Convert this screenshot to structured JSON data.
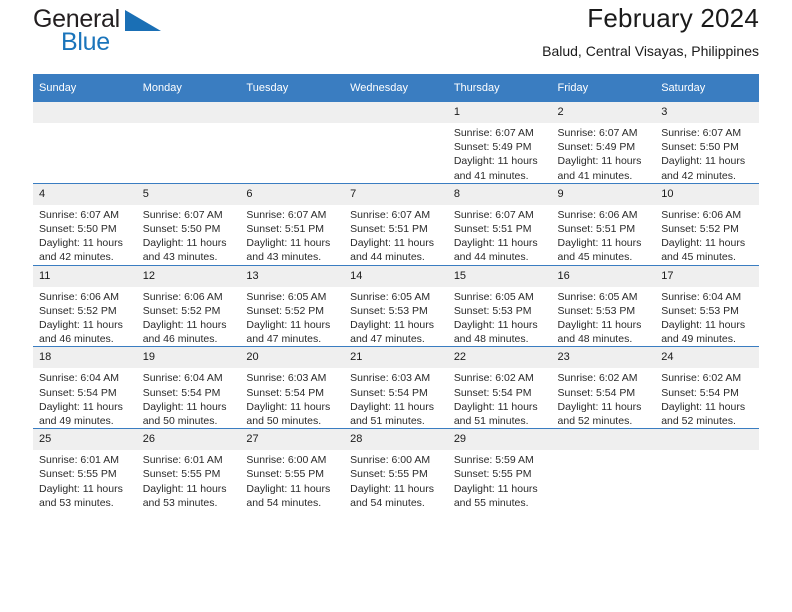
{
  "brand": {
    "name_top": "General",
    "name_bottom": "Blue",
    "triangle_icon": "triangle-icon",
    "color_top": "#231f20",
    "color_bottom": "#1a74bb"
  },
  "header": {
    "title": "February 2024",
    "subtitle": "Balud, Central Visayas, Philippines"
  },
  "theme": {
    "header_bg": "#3a7dc1",
    "header_text": "#ffffff",
    "daynum_bg": "#efefef",
    "cell_bg": "#ffffff",
    "grid_line": "#3a7dc1"
  },
  "weekday_headers": [
    "Sunday",
    "Monday",
    "Tuesday",
    "Wednesday",
    "Thursday",
    "Friday",
    "Saturday"
  ],
  "weeks": [
    [
      {
        "day": "",
        "sunrise": "",
        "sunset": "",
        "daylight_line1": "",
        "daylight_line2": ""
      },
      {
        "day": "",
        "sunrise": "",
        "sunset": "",
        "daylight_line1": "",
        "daylight_line2": ""
      },
      {
        "day": "",
        "sunrise": "",
        "sunset": "",
        "daylight_line1": "",
        "daylight_line2": ""
      },
      {
        "day": "",
        "sunrise": "",
        "sunset": "",
        "daylight_line1": "",
        "daylight_line2": ""
      },
      {
        "day": "1",
        "sunrise": "Sunrise: 6:07 AM",
        "sunset": "Sunset: 5:49 PM",
        "daylight_line1": "Daylight: 11 hours",
        "daylight_line2": "and 41 minutes."
      },
      {
        "day": "2",
        "sunrise": "Sunrise: 6:07 AM",
        "sunset": "Sunset: 5:49 PM",
        "daylight_line1": "Daylight: 11 hours",
        "daylight_line2": "and 41 minutes."
      },
      {
        "day": "3",
        "sunrise": "Sunrise: 6:07 AM",
        "sunset": "Sunset: 5:50 PM",
        "daylight_line1": "Daylight: 11 hours",
        "daylight_line2": "and 42 minutes."
      }
    ],
    [
      {
        "day": "4",
        "sunrise": "Sunrise: 6:07 AM",
        "sunset": "Sunset: 5:50 PM",
        "daylight_line1": "Daylight: 11 hours",
        "daylight_line2": "and 42 minutes."
      },
      {
        "day": "5",
        "sunrise": "Sunrise: 6:07 AM",
        "sunset": "Sunset: 5:50 PM",
        "daylight_line1": "Daylight: 11 hours",
        "daylight_line2": "and 43 minutes."
      },
      {
        "day": "6",
        "sunrise": "Sunrise: 6:07 AM",
        "sunset": "Sunset: 5:51 PM",
        "daylight_line1": "Daylight: 11 hours",
        "daylight_line2": "and 43 minutes."
      },
      {
        "day": "7",
        "sunrise": "Sunrise: 6:07 AM",
        "sunset": "Sunset: 5:51 PM",
        "daylight_line1": "Daylight: 11 hours",
        "daylight_line2": "and 44 minutes."
      },
      {
        "day": "8",
        "sunrise": "Sunrise: 6:07 AM",
        "sunset": "Sunset: 5:51 PM",
        "daylight_line1": "Daylight: 11 hours",
        "daylight_line2": "and 44 minutes."
      },
      {
        "day": "9",
        "sunrise": "Sunrise: 6:06 AM",
        "sunset": "Sunset: 5:51 PM",
        "daylight_line1": "Daylight: 11 hours",
        "daylight_line2": "and 45 minutes."
      },
      {
        "day": "10",
        "sunrise": "Sunrise: 6:06 AM",
        "sunset": "Sunset: 5:52 PM",
        "daylight_line1": "Daylight: 11 hours",
        "daylight_line2": "and 45 minutes."
      }
    ],
    [
      {
        "day": "11",
        "sunrise": "Sunrise: 6:06 AM",
        "sunset": "Sunset: 5:52 PM",
        "daylight_line1": "Daylight: 11 hours",
        "daylight_line2": "and 46 minutes."
      },
      {
        "day": "12",
        "sunrise": "Sunrise: 6:06 AM",
        "sunset": "Sunset: 5:52 PM",
        "daylight_line1": "Daylight: 11 hours",
        "daylight_line2": "and 46 minutes."
      },
      {
        "day": "13",
        "sunrise": "Sunrise: 6:05 AM",
        "sunset": "Sunset: 5:52 PM",
        "daylight_line1": "Daylight: 11 hours",
        "daylight_line2": "and 47 minutes."
      },
      {
        "day": "14",
        "sunrise": "Sunrise: 6:05 AM",
        "sunset": "Sunset: 5:53 PM",
        "daylight_line1": "Daylight: 11 hours",
        "daylight_line2": "and 47 minutes."
      },
      {
        "day": "15",
        "sunrise": "Sunrise: 6:05 AM",
        "sunset": "Sunset: 5:53 PM",
        "daylight_line1": "Daylight: 11 hours",
        "daylight_line2": "and 48 minutes."
      },
      {
        "day": "16",
        "sunrise": "Sunrise: 6:05 AM",
        "sunset": "Sunset: 5:53 PM",
        "daylight_line1": "Daylight: 11 hours",
        "daylight_line2": "and 48 minutes."
      },
      {
        "day": "17",
        "sunrise": "Sunrise: 6:04 AM",
        "sunset": "Sunset: 5:53 PM",
        "daylight_line1": "Daylight: 11 hours",
        "daylight_line2": "and 49 minutes."
      }
    ],
    [
      {
        "day": "18",
        "sunrise": "Sunrise: 6:04 AM",
        "sunset": "Sunset: 5:54 PM",
        "daylight_line1": "Daylight: 11 hours",
        "daylight_line2": "and 49 minutes."
      },
      {
        "day": "19",
        "sunrise": "Sunrise: 6:04 AM",
        "sunset": "Sunset: 5:54 PM",
        "daylight_line1": "Daylight: 11 hours",
        "daylight_line2": "and 50 minutes."
      },
      {
        "day": "20",
        "sunrise": "Sunrise: 6:03 AM",
        "sunset": "Sunset: 5:54 PM",
        "daylight_line1": "Daylight: 11 hours",
        "daylight_line2": "and 50 minutes."
      },
      {
        "day": "21",
        "sunrise": "Sunrise: 6:03 AM",
        "sunset": "Sunset: 5:54 PM",
        "daylight_line1": "Daylight: 11 hours",
        "daylight_line2": "and 51 minutes."
      },
      {
        "day": "22",
        "sunrise": "Sunrise: 6:02 AM",
        "sunset": "Sunset: 5:54 PM",
        "daylight_line1": "Daylight: 11 hours",
        "daylight_line2": "and 51 minutes."
      },
      {
        "day": "23",
        "sunrise": "Sunrise: 6:02 AM",
        "sunset": "Sunset: 5:54 PM",
        "daylight_line1": "Daylight: 11 hours",
        "daylight_line2": "and 52 minutes."
      },
      {
        "day": "24",
        "sunrise": "Sunrise: 6:02 AM",
        "sunset": "Sunset: 5:54 PM",
        "daylight_line1": "Daylight: 11 hours",
        "daylight_line2": "and 52 minutes."
      }
    ],
    [
      {
        "day": "25",
        "sunrise": "Sunrise: 6:01 AM",
        "sunset": "Sunset: 5:55 PM",
        "daylight_line1": "Daylight: 11 hours",
        "daylight_line2": "and 53 minutes."
      },
      {
        "day": "26",
        "sunrise": "Sunrise: 6:01 AM",
        "sunset": "Sunset: 5:55 PM",
        "daylight_line1": "Daylight: 11 hours",
        "daylight_line2": "and 53 minutes."
      },
      {
        "day": "27",
        "sunrise": "Sunrise: 6:00 AM",
        "sunset": "Sunset: 5:55 PM",
        "daylight_line1": "Daylight: 11 hours",
        "daylight_line2": "and 54 minutes."
      },
      {
        "day": "28",
        "sunrise": "Sunrise: 6:00 AM",
        "sunset": "Sunset: 5:55 PM",
        "daylight_line1": "Daylight: 11 hours",
        "daylight_line2": "and 54 minutes."
      },
      {
        "day": "29",
        "sunrise": "Sunrise: 5:59 AM",
        "sunset": "Sunset: 5:55 PM",
        "daylight_line1": "Daylight: 11 hours",
        "daylight_line2": "and 55 minutes."
      },
      {
        "day": "",
        "sunrise": "",
        "sunset": "",
        "daylight_line1": "",
        "daylight_line2": ""
      },
      {
        "day": "",
        "sunrise": "",
        "sunset": "",
        "daylight_line1": "",
        "daylight_line2": ""
      }
    ]
  ]
}
